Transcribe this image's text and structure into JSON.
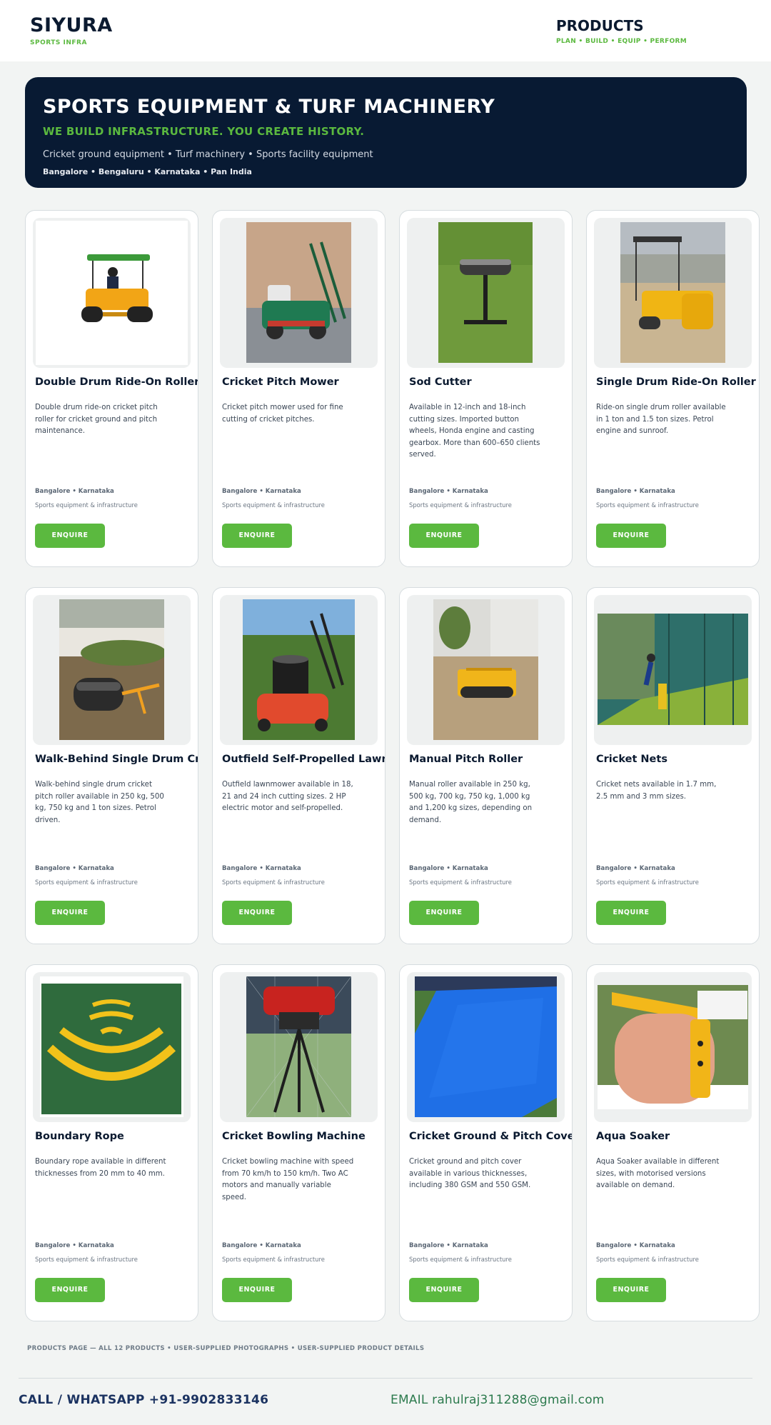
{
  "header": {
    "brand": "SIYURA",
    "brand_sub": "SPORTS INFRA",
    "nav_title": "PRODUCTS",
    "nav_sub": "PLAN • BUILD • EQUIP • PERFORM"
  },
  "hero": {
    "title": "SPORTS EQUIPMENT & TURF MACHINERY",
    "tagline": "WE BUILD INFRASTRUCTURE. YOU CREATE HISTORY.",
    "line": "Cricket ground equipment • Turf machinery • Sports facility equipment",
    "locations": "Bangalore • Bengaluru • Karnataka • Pan India"
  },
  "products": [
    {
      "title": "Double Drum Ride-On Roller",
      "desc": "Double drum ride-on cricket pitch roller for cricket ground and pitch maintenance.",
      "icon": "double-drum-roller-photo"
    },
    {
      "title": "Cricket Pitch Mower",
      "desc": "Cricket pitch mower used for fine cutting of cricket pitches.",
      "icon": "pitch-mower-photo"
    },
    {
      "title": "Sod Cutter",
      "desc": "Available in 12-inch and 18-inch cutting sizes. Imported button wheels, Honda engine and casting gearbox. More than 600–650 clients served.",
      "icon": "sod-cutter-photo"
    },
    {
      "title": "Single Drum Ride-On Roller",
      "desc": "Ride-on single drum roller available in 1 ton and 1.5 ton sizes. Petrol engine and sunroof.",
      "icon": "single-drum-roller-photo"
    },
    {
      "title": "Walk-Behind Single Drum Cricket Roller",
      "desc": "Walk-behind single drum cricket pitch roller available in 250 kg, 500 kg, 750 kg and 1 ton sizes. Petrol driven.",
      "icon": "walk-behind-roller-photo"
    },
    {
      "title": "Outfield Self-Propelled Lawnmower",
      "desc": "Outfield lawnmower available in 18, 21 and 24 inch cutting sizes. 2 HP electric motor and self-propelled.",
      "icon": "lawnmower-photo"
    },
    {
      "title": "Manual Pitch Roller",
      "desc": "Manual roller available in 250 kg, 500 kg, 700 kg, 750 kg, 1,000 kg and 1,200 kg sizes, depending on demand.",
      "icon": "manual-roller-photo"
    },
    {
      "title": "Cricket Nets",
      "desc": "Cricket nets available in 1.7 mm, 2.5 mm and 3 mm sizes.",
      "icon": "cricket-nets-photo"
    },
    {
      "title": "Boundary Rope",
      "desc": "Boundary rope available in different thicknesses from 20 mm to 40 mm.",
      "icon": "boundary-rope-photo"
    },
    {
      "title": "Cricket Bowling Machine",
      "desc": "Cricket bowling machine with speed from 70 km/h to 150 km/h. Two AC motors and manually variable speed.",
      "icon": "bowling-machine-photo"
    },
    {
      "title": "Cricket Ground & Pitch Cover",
      "desc": "Cricket ground and pitch cover available in various thicknesses, including 380 GSM and 550 GSM.",
      "icon": "pitch-cover-photo"
    },
    {
      "title": "Aqua Soaker",
      "desc": "Aqua Soaker available in different sizes, with motorised versions available on demand.",
      "icon": "aqua-soaker-photo"
    }
  ],
  "card_common": {
    "location": "Bangalore • Karnataka",
    "category": "Sports equipment & infrastructure",
    "button": "ENQUIRE"
  },
  "footnote": "PRODUCTS PAGE — ALL 12 PRODUCTS • USER-SUPPLIED PHOTOGRAPHS • USER-SUPPLIED PRODUCT DETAILS",
  "footer": {
    "call": "CALL / WHATSAPP  +91-9902833146",
    "email": "EMAIL  rahulraj311288@gmail.com"
  },
  "colors": {
    "navy": "#081a33",
    "accent": "#5bb93f",
    "bg": "#f2f4f3"
  }
}
